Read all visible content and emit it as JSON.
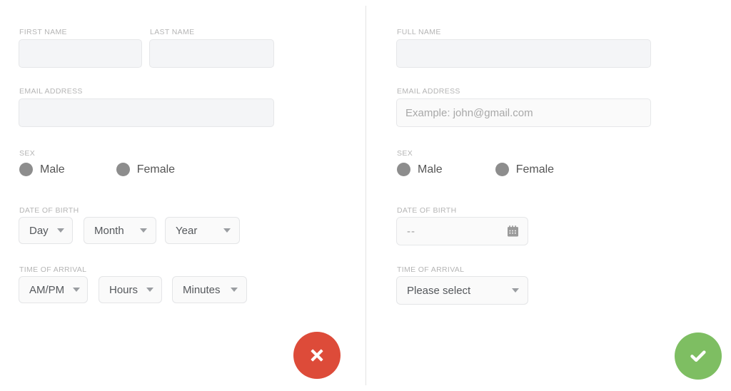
{
  "colors": {
    "background": "#ffffff",
    "divider": "#e3e3e3",
    "label_text": "#b5b5b5",
    "input_fill": "#f4f5f7",
    "input_border": "#e6e7e9",
    "select_fill": "#fafafa",
    "radio_fill": "#8d8d8d",
    "body_text": "#555555",
    "cancel_red": "#dd4b39",
    "confirm_green": "#7ebe62"
  },
  "left_form": {
    "first_name": {
      "label": "FIRST NAME",
      "value": "",
      "placeholder": ""
    },
    "last_name": {
      "label": "LAST NAME",
      "value": "",
      "placeholder": ""
    },
    "email": {
      "label": "EMAIL ADDRESS",
      "value": "",
      "placeholder": ""
    },
    "sex": {
      "label": "SEX",
      "options": [
        {
          "label": "Male",
          "icon": "radio-filled-icon"
        },
        {
          "label": "Female",
          "icon": "radio-filled-icon"
        }
      ]
    },
    "date_of_birth": {
      "label": "DATE OF BIRTH",
      "selects": [
        {
          "value": "Day",
          "icon": "chevron-down-icon"
        },
        {
          "value": "Month",
          "icon": "chevron-down-icon"
        },
        {
          "value": "Year",
          "icon": "chevron-down-icon"
        }
      ]
    },
    "time_of_arrival": {
      "label": "TIME OF ARRIVAL",
      "selects": [
        {
          "value": "AM/PM",
          "icon": "chevron-down-icon"
        },
        {
          "value": "Hours",
          "icon": "chevron-down-icon"
        },
        {
          "value": "Minutes",
          "icon": "chevron-down-icon"
        }
      ]
    },
    "action_button": {
      "icon": "close-x-icon",
      "color": "#dd4b39"
    }
  },
  "right_form": {
    "full_name": {
      "label": "FULL NAME",
      "value": "",
      "placeholder": ""
    },
    "email": {
      "label": "EMAIL ADDRESS",
      "value": "",
      "placeholder": "Example: john@gmail.com"
    },
    "sex": {
      "label": "SEX",
      "options": [
        {
          "label": "Male",
          "icon": "radio-filled-icon"
        },
        {
          "label": "Female",
          "icon": "radio-filled-icon"
        }
      ]
    },
    "date_of_birth": {
      "label": "DATE OF BIRTH",
      "placeholder": "--",
      "icon": "calendar-icon"
    },
    "time_of_arrival": {
      "label": "TIME OF ARRIVAL",
      "select": {
        "value": "Please select",
        "icon": "chevron-down-icon"
      }
    },
    "action_button": {
      "icon": "check-mark-icon",
      "color": "#7ebe62"
    }
  }
}
